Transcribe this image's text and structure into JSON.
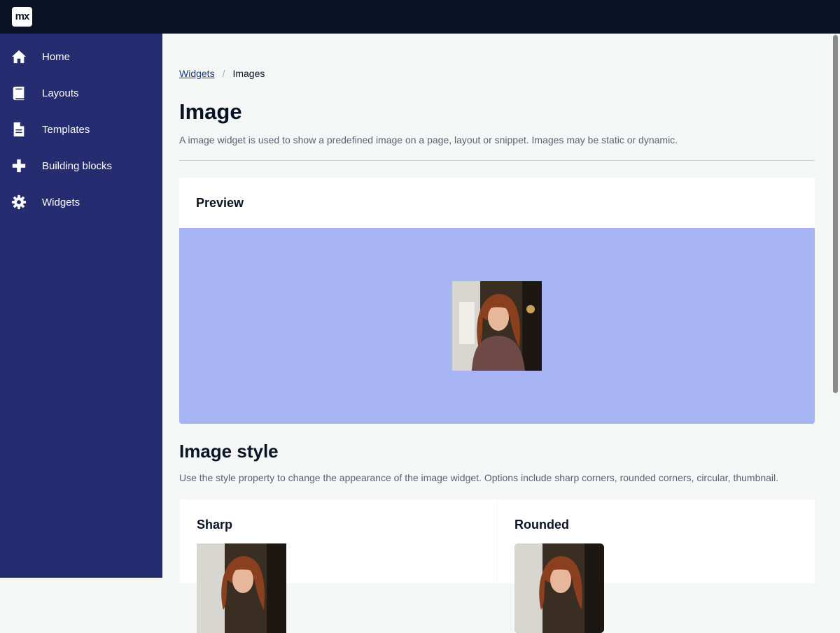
{
  "app": {
    "logo_text": "mx"
  },
  "sidebar": {
    "items": [
      {
        "label": "Home",
        "icon": "home-icon"
      },
      {
        "label": "Layouts",
        "icon": "book-icon"
      },
      {
        "label": "Templates",
        "icon": "file-icon"
      },
      {
        "label": "Building blocks",
        "icon": "plus-icon"
      },
      {
        "label": "Widgets",
        "icon": "gear-icon"
      }
    ]
  },
  "breadcrumb": {
    "link": "Widgets",
    "separator": "/",
    "current": "Images"
  },
  "page": {
    "title": "Image",
    "description": "A image widget is used to show a predefined image on a page, layout or snippet. Images may be static or dynamic."
  },
  "preview": {
    "header": "Preview"
  },
  "image_style": {
    "title": "Image style",
    "description": "Use the style property to change the appearance of the image widget. Options include sharp corners, rounded corners, circular, thumbnail.",
    "cards": [
      {
        "label": "Sharp"
      },
      {
        "label": "Rounded"
      }
    ]
  },
  "colors": {
    "topbar": "#0a1326",
    "sidebar": "#252c6f",
    "preview_background": "#a7b5f4",
    "page_background": "#f5f6f6"
  }
}
